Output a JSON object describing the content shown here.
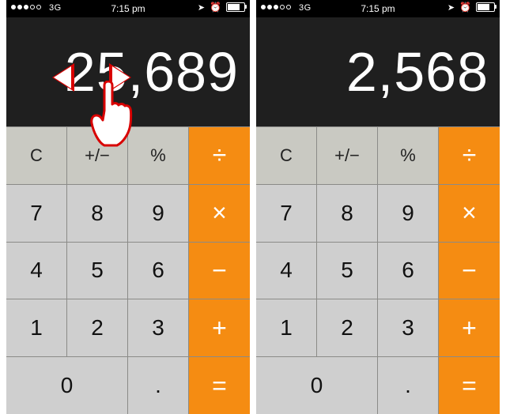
{
  "status": {
    "network": "3G",
    "time": "7:15 pm",
    "signal_filled": 3,
    "battery_pct": 70
  },
  "screens": {
    "left_display": "25,689",
    "right_display": "2,568"
  },
  "keys": {
    "clear": "C",
    "sign": "+/−",
    "percent": "%",
    "divide": "÷",
    "seven": "7",
    "eight": "8",
    "nine": "9",
    "multiply": "×",
    "four": "4",
    "five": "5",
    "six": "6",
    "minus": "−",
    "one": "1",
    "two": "2",
    "three": "3",
    "plus": "+",
    "zero": "0",
    "dot": ".",
    "equals": "="
  },
  "gesture": {
    "description": "swipe-left-or-right-to-delete-digit"
  }
}
